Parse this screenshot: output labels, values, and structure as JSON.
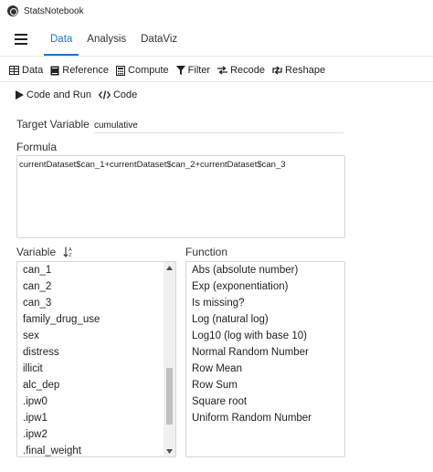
{
  "app": {
    "title": "StatsNotebook"
  },
  "nav": {
    "tabs": [
      "Data",
      "Analysis",
      "DataViz"
    ],
    "active": "Data"
  },
  "toolbar": {
    "items": [
      {
        "label": "Data",
        "icon": "table-icon"
      },
      {
        "label": "Reference",
        "icon": "book-icon"
      },
      {
        "label": "Compute",
        "icon": "calculator-icon"
      },
      {
        "label": "Filter",
        "icon": "filter-icon"
      },
      {
        "label": "Recode",
        "icon": "swap-icon"
      },
      {
        "label": "Reshape",
        "icon": "reshape-icon"
      }
    ],
    "run_label": "Code and Run",
    "code_label": "Code"
  },
  "target": {
    "label": "Target Variable",
    "value": "cumulative"
  },
  "formula": {
    "label": "Formula",
    "value": "currentDataset$can_1+currentDataset$can_2+currentDataset$can_3"
  },
  "variables": {
    "label": "Variable",
    "items": [
      "can_1",
      "can_2",
      "can_3",
      "family_drug_use",
      "sex",
      "distress",
      "illicit",
      "alc_dep",
      ".ipw0",
      ".ipw1",
      ".ipw2",
      ".final_weight"
    ],
    "scroll_position": 0.82,
    "visible_fraction": 0.33
  },
  "functions": {
    "label": "Function",
    "items": [
      "Abs (absolute number)",
      "Exp (exponentiation)",
      "Is missing?",
      "Log (natural log)",
      "Log10 (log with base 10)",
      "Normal Random Number",
      "Row Mean",
      "Row Sum",
      "Square root",
      "Uniform Random Number"
    ]
  },
  "colors": {
    "accent": "#1976d2"
  }
}
